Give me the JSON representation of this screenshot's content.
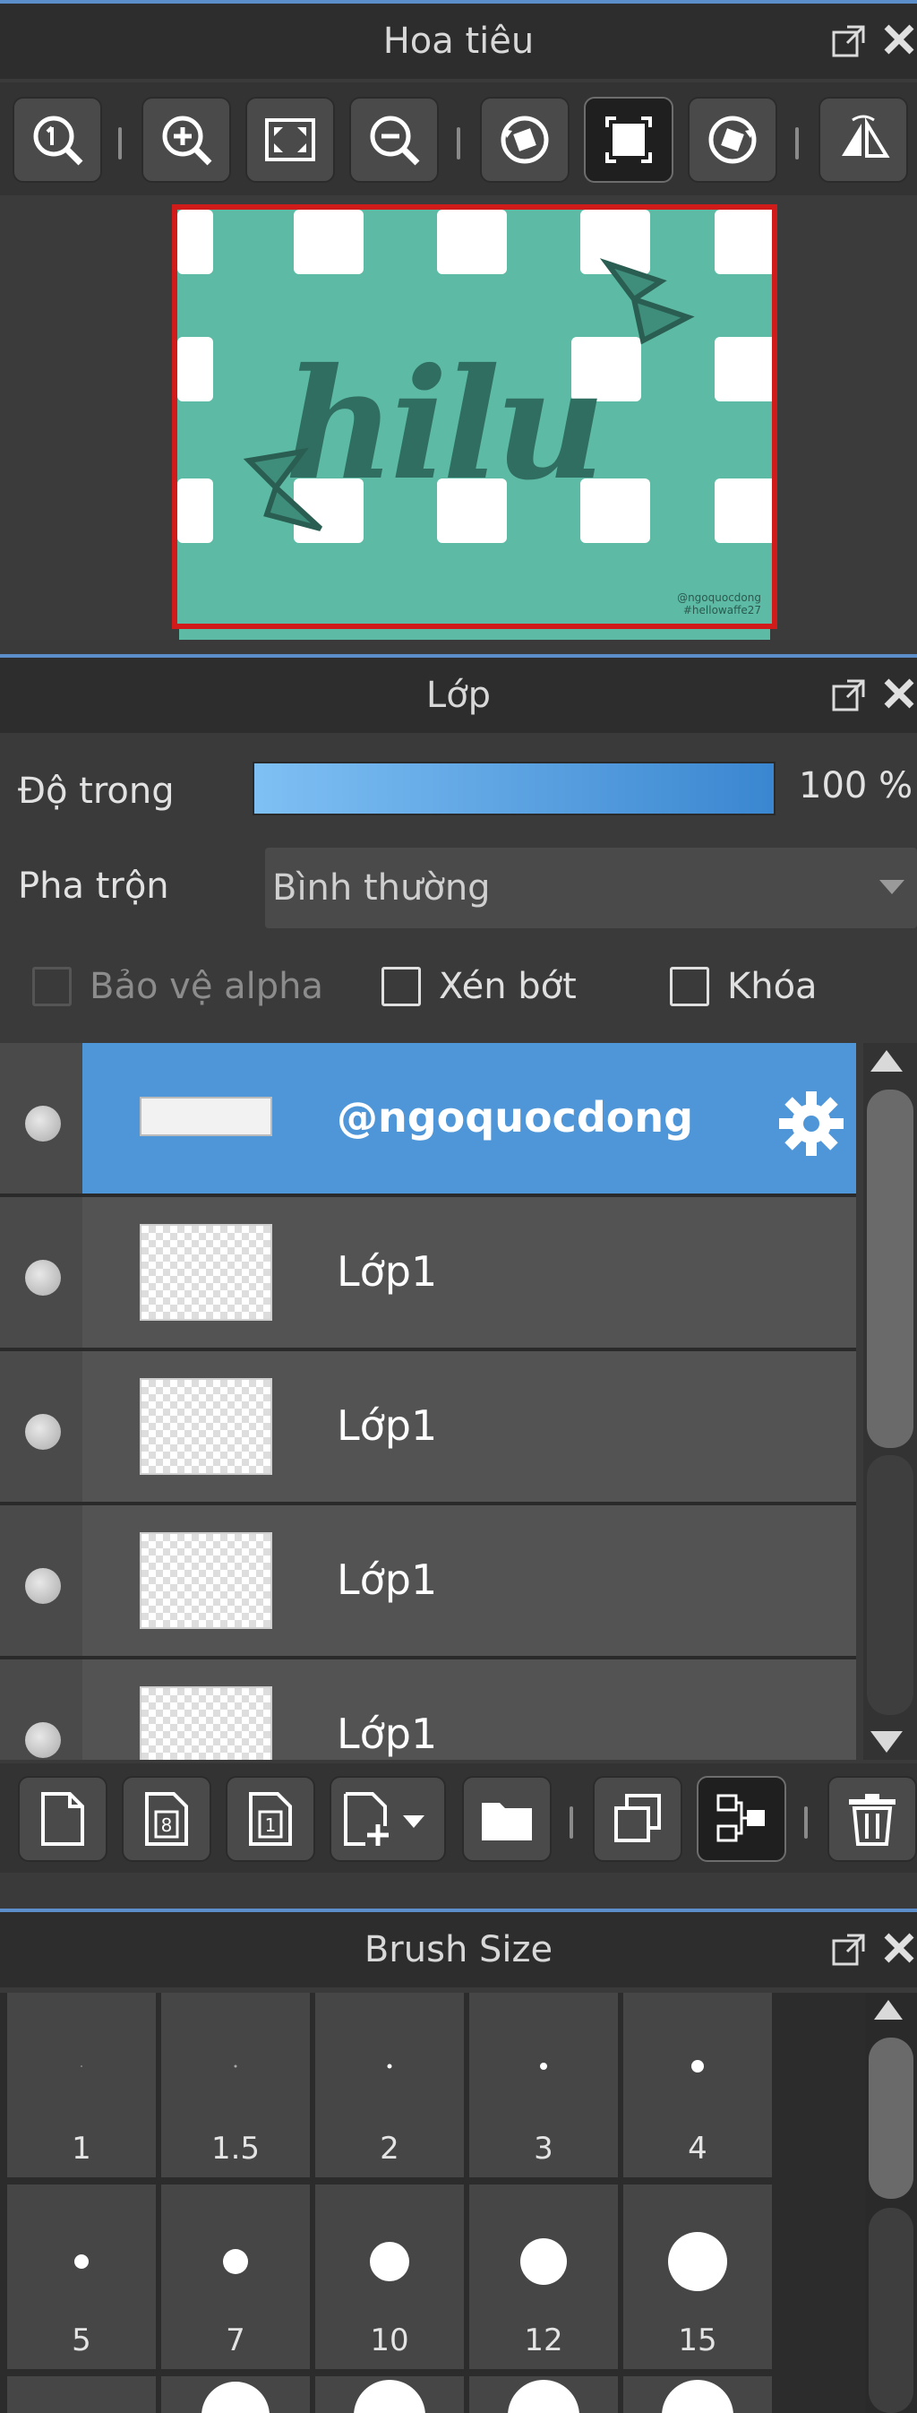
{
  "navigator": {
    "title": "Hoa tiêu",
    "tools": [
      {
        "icon": "zoom-actual-icon"
      },
      {
        "icon": "zoom-in-icon"
      },
      {
        "icon": "fit-screen-icon"
      },
      {
        "icon": "zoom-out-icon"
      },
      {
        "icon": "rotate-left-icon"
      },
      {
        "icon": "reset-rotation-icon",
        "active": true
      },
      {
        "icon": "rotate-right-icon"
      },
      {
        "icon": "flip-horizontal-icon"
      }
    ],
    "preview": {
      "artwork_text": "hilu",
      "watermark_lines": [
        "@ngoquocdong",
        "#hellowaffe27"
      ]
    }
  },
  "layers": {
    "title": "Lớp",
    "opacity_label": "Độ trong",
    "opacity_value": "100 %",
    "opacity_percent": 100,
    "blend_label": "Pha trộn",
    "blend_value": "Bình thường",
    "options": {
      "protect_alpha": "Bảo vệ alpha",
      "clipping": "Xén bớt",
      "lock": "Khóa"
    },
    "items": [
      {
        "name": "@ngoquocdong",
        "selected": true
      },
      {
        "name": "Lớp1",
        "selected": false
      },
      {
        "name": "Lớp1",
        "selected": false
      },
      {
        "name": "Lớp1",
        "selected": false
      },
      {
        "name": "Lớp1",
        "selected": false
      }
    ],
    "toolbar": [
      {
        "icon": "new-layer-icon"
      },
      {
        "icon": "new-8bit-layer-icon"
      },
      {
        "icon": "new-1bit-layer-icon"
      },
      {
        "icon": "add-layer-dropdown-icon"
      },
      {
        "icon": "new-folder-icon"
      },
      {
        "icon": "duplicate-layer-icon"
      },
      {
        "icon": "merge-down-icon"
      },
      {
        "icon": "delete-layer-icon"
      }
    ]
  },
  "brush_size": {
    "title": "Brush Size",
    "sizes": [
      "1",
      "1.5",
      "2",
      "3",
      "4",
      "5",
      "7",
      "10",
      "12",
      "15"
    ]
  },
  "colors": {
    "accent": "#4e96d8",
    "preview_border": "#d11a1a",
    "canvas_teal": "#5dbaa4"
  }
}
